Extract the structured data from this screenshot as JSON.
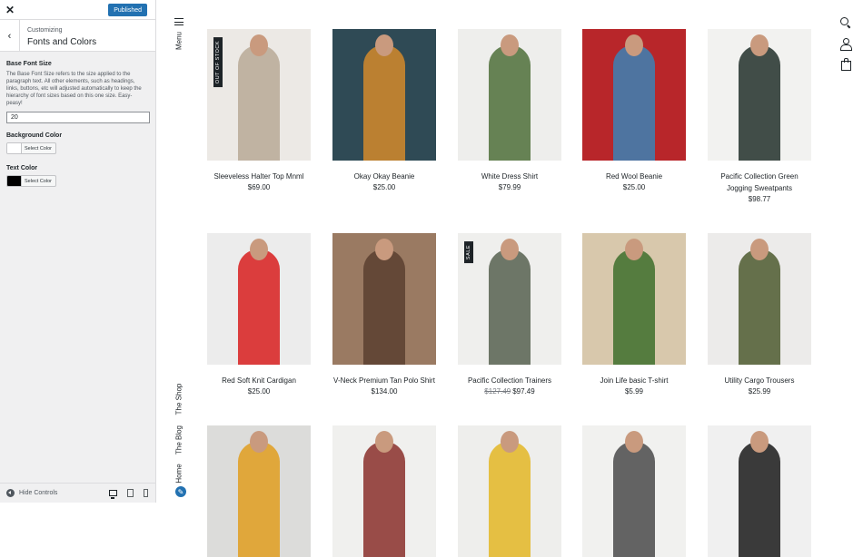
{
  "customizer": {
    "close_icon": "✕",
    "publish_label": "Published",
    "back_icon": "‹",
    "section_sub": "Customizing",
    "section_title": "Fonts and Colors",
    "base_font_title": "Base Font Size",
    "base_font_desc": "The Base Font Size refers to the size applied to the paragraph text. All other elements, such as headings, links, buttons, etc will adjusted automatically to keep the hierarchy of font sizes based on this one size. Easy-peasy!",
    "base_font_value": "20",
    "bg_color_title": "Background Color",
    "bg_color_label": "Select Color",
    "bg_color_value": "#ffffff",
    "text_color_title": "Text Color",
    "text_color_label": "Select Color",
    "text_color_value": "#000000",
    "hide_controls": "Hide Controls"
  },
  "rail": {
    "menu": "Menu",
    "shop": "The Shop",
    "blog": "The Blog",
    "home": "Home",
    "edit_icon": "✎"
  },
  "products": [
    {
      "name": "Sleeveless Halter Top Mnml",
      "price": "$69.00",
      "badge": "OUT OF STOCK",
      "bg": "#ece9e5",
      "fg": "#b9a996"
    },
    {
      "name": "Okay Okay Beanie",
      "price": "$25.00",
      "bg": "#2f4a55",
      "fg": "#d48a2c"
    },
    {
      "name": "White Dress Shirt",
      "price": "$79.99",
      "bg": "#eeeeec",
      "fg": "#4e6f3a"
    },
    {
      "name": "Red Wool Beanie",
      "price": "$25.00",
      "bg": "#b8262a",
      "fg": "#3b82b5"
    },
    {
      "name": "Pacific Collection Green Jogging Sweatpants",
      "price": "$98.77",
      "bg": "#f2f2f0",
      "fg": "#22302a"
    },
    {
      "name": "Red Soft Knit Cardigan",
      "price": "$25.00",
      "bg": "#ececec",
      "fg": "#d81f1f"
    },
    {
      "name": "V-Neck Premium Tan Polo Shirt",
      "price": "$134.00",
      "bg": "#9a7a62",
      "fg": "#5a3f30"
    },
    {
      "name": "Pacific Collection Trainers",
      "price": "$97.49",
      "old_price": "$127.49",
      "badge": "SALE",
      "bg": "#efefed",
      "fg": "#56604f"
    },
    {
      "name": "Join Life basic T-shirt",
      "price": "$5.99",
      "bg": "#d8c8ac",
      "fg": "#3e6e2c"
    },
    {
      "name": "Utility Cargo Trousers",
      "price": "$25.99",
      "bg": "#ecebea",
      "fg": "#4e5a2f"
    },
    {
      "bg": "#dcdcda",
      "fg": "#e09d1f"
    },
    {
      "bg": "#f0f0ee",
      "fg": "#8a2f2a"
    },
    {
      "bg": "#eeeeec",
      "fg": "#e3b626"
    },
    {
      "bg": "#f1f1ef",
      "fg": "#4a4a4a"
    },
    {
      "bg": "#f0f0f0",
      "fg": "#1a1a1a"
    }
  ]
}
